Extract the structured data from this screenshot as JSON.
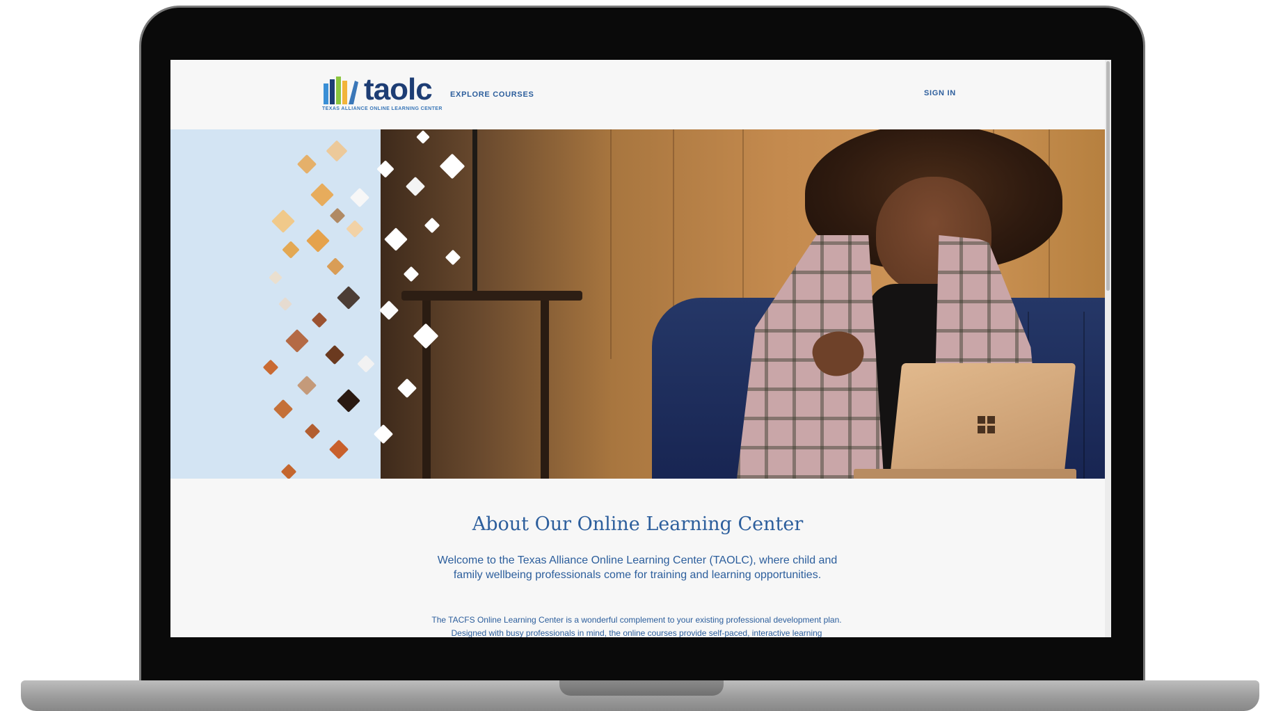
{
  "site": {
    "logo_text": "taolc",
    "logo_subtitle": "TEXAS ALLIANCE ONLINE LEARNING CENTER",
    "logo_bar_colors": [
      "#3a8fd6",
      "#1d3d74",
      "#8cc63f",
      "#f2b43a",
      "#3a77b8"
    ]
  },
  "nav": {
    "explore_label": "EXPLORE COURSES",
    "signin_label": "SIGN IN"
  },
  "hero": {
    "image_alt": "Woman smiling while using a laptop on a blue sofa"
  },
  "about": {
    "title": "About Our Online Learning Center",
    "lead": "Welcome to the Texas Alliance Online Learning Center (TAOLC), where child and family wellbeing professionals come for training and learning opportunities.",
    "body": "The TACFS Online Learning Center is a wonderful complement to your existing professional development plan. Designed with busy professionals in mind, the online courses provide self-paced, interactive learning"
  },
  "colors": {
    "brand_navy": "#1d3d74",
    "link_blue": "#2c5e9c",
    "hero_panel": "#d3e4f3"
  }
}
